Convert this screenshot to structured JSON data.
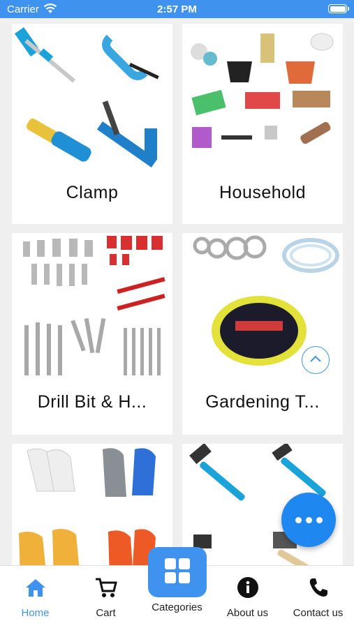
{
  "status_bar": {
    "carrier": "Carrier",
    "time": "2:57 PM",
    "battery_level": 1.0
  },
  "categories": [
    {
      "label": "Clamp"
    },
    {
      "label": "Household"
    },
    {
      "label": "Drill Bit & H..."
    },
    {
      "label": "Gardening T..."
    },
    {
      "label": ""
    },
    {
      "label": ""
    }
  ],
  "tabs": [
    {
      "label": "Home",
      "icon": "home-icon",
      "active": true
    },
    {
      "label": "Cart",
      "icon": "cart-icon"
    },
    {
      "label": "Categories",
      "icon": "grid-icon"
    },
    {
      "label": "About us",
      "icon": "info-icon"
    },
    {
      "label": "Contact us",
      "icon": "phone-icon"
    }
  ],
  "colors": {
    "accent": "#3f93ee",
    "fab": "#1e88f0",
    "background": "#efefef"
  }
}
